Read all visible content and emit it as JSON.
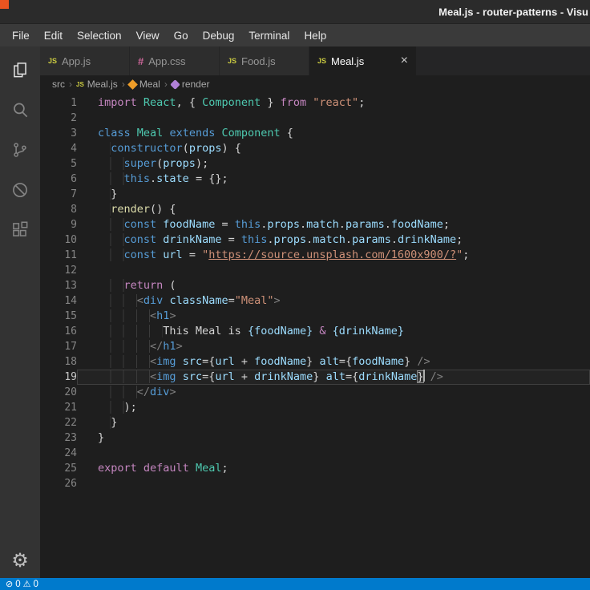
{
  "window": {
    "title": "Meal.js - router-patterns - Visu",
    "corner_marker_color": "#e95420"
  },
  "menu": [
    "File",
    "Edit",
    "Selection",
    "View",
    "Go",
    "Debug",
    "Terminal",
    "Help"
  ],
  "tabs": [
    {
      "label": "App.js",
      "icon": "js",
      "active": false
    },
    {
      "label": "App.css",
      "icon": "css",
      "active": false
    },
    {
      "label": "Food.js",
      "icon": "js",
      "active": false
    },
    {
      "label": "Meal.js",
      "icon": "js",
      "active": true
    }
  ],
  "breadcrumb": [
    {
      "label": "src"
    },
    {
      "label": "Meal.js",
      "icon": "js"
    },
    {
      "label": "Meal",
      "icon": "class"
    },
    {
      "label": "render",
      "icon": "method"
    }
  ],
  "activity_bar": {
    "items": [
      "explorer",
      "search",
      "source-control",
      "debug",
      "extensions"
    ],
    "bottom": [
      "settings-gear"
    ]
  },
  "icons": {
    "close": "×",
    "breadcrumb_separator": "›",
    "error": "⊘",
    "warning": "⚠",
    "settings_gear": "⚙"
  },
  "status_bar": {
    "errors": "0",
    "warnings": "0"
  },
  "theme": {
    "accent": "#007acc",
    "editor_bg": "#1e1e1e",
    "activity_bar_bg": "#333333",
    "tab_bg": "#2d2d2d",
    "tab_active_bg": "#1e1e1e"
  },
  "editor": {
    "lines": [
      {
        "num": 1,
        "tokens": [
          {
            "c": "kw",
            "t": "import"
          },
          {
            "c": "txt",
            "t": " "
          },
          {
            "c": "type",
            "t": "React"
          },
          {
            "c": "txt",
            "t": ", { "
          },
          {
            "c": "type",
            "t": "Component"
          },
          {
            "c": "txt",
            "t": " } "
          },
          {
            "c": "kw",
            "t": "from"
          },
          {
            "c": "txt",
            "t": " "
          },
          {
            "c": "str",
            "t": "\"react\""
          },
          {
            "c": "txt",
            "t": ";"
          }
        ]
      },
      {
        "num": 2,
        "tokens": []
      },
      {
        "num": 3,
        "tokens": [
          {
            "c": "kw2",
            "t": "class"
          },
          {
            "c": "txt",
            "t": " "
          },
          {
            "c": "type",
            "t": "Meal"
          },
          {
            "c": "txt",
            "t": " "
          },
          {
            "c": "kw2",
            "t": "extends"
          },
          {
            "c": "txt",
            "t": " "
          },
          {
            "c": "type",
            "t": "Component"
          },
          {
            "c": "txt",
            "t": " {"
          }
        ]
      },
      {
        "num": 4,
        "tokens": [
          {
            "c": "ind",
            "t": "  "
          },
          {
            "c": "kw2",
            "t": "constructor"
          },
          {
            "c": "txt",
            "t": "("
          },
          {
            "c": "var",
            "t": "props"
          },
          {
            "c": "txt",
            "t": ") {"
          }
        ]
      },
      {
        "num": 5,
        "tokens": [
          {
            "c": "ind",
            "t": "    "
          },
          {
            "c": "kw2",
            "t": "super"
          },
          {
            "c": "txt",
            "t": "("
          },
          {
            "c": "var",
            "t": "props"
          },
          {
            "c": "txt",
            "t": ");"
          }
        ]
      },
      {
        "num": 6,
        "tokens": [
          {
            "c": "ind",
            "t": "    "
          },
          {
            "c": "kw2",
            "t": "this"
          },
          {
            "c": "txt",
            "t": "."
          },
          {
            "c": "var",
            "t": "state"
          },
          {
            "c": "txt",
            "t": " = {};"
          }
        ]
      },
      {
        "num": 7,
        "tokens": [
          {
            "c": "ind",
            "t": "  "
          },
          {
            "c": "txt",
            "t": "}"
          }
        ]
      },
      {
        "num": 8,
        "tokens": [
          {
            "c": "ind",
            "t": "  "
          },
          {
            "c": "fn",
            "t": "render"
          },
          {
            "c": "txt",
            "t": "() {"
          }
        ]
      },
      {
        "num": 9,
        "tokens": [
          {
            "c": "ind",
            "t": "    "
          },
          {
            "c": "kw2",
            "t": "const"
          },
          {
            "c": "txt",
            "t": " "
          },
          {
            "c": "var",
            "t": "foodName"
          },
          {
            "c": "txt",
            "t": " = "
          },
          {
            "c": "kw2",
            "t": "this"
          },
          {
            "c": "txt",
            "t": "."
          },
          {
            "c": "var",
            "t": "props"
          },
          {
            "c": "txt",
            "t": "."
          },
          {
            "c": "var",
            "t": "match"
          },
          {
            "c": "txt",
            "t": "."
          },
          {
            "c": "var",
            "t": "params"
          },
          {
            "c": "txt",
            "t": "."
          },
          {
            "c": "var",
            "t": "foodName"
          },
          {
            "c": "txt",
            "t": ";"
          }
        ]
      },
      {
        "num": 10,
        "tokens": [
          {
            "c": "ind",
            "t": "    "
          },
          {
            "c": "kw2",
            "t": "const"
          },
          {
            "c": "txt",
            "t": " "
          },
          {
            "c": "var",
            "t": "drinkName"
          },
          {
            "c": "txt",
            "t": " = "
          },
          {
            "c": "kw2",
            "t": "this"
          },
          {
            "c": "txt",
            "t": "."
          },
          {
            "c": "var",
            "t": "props"
          },
          {
            "c": "txt",
            "t": "."
          },
          {
            "c": "var",
            "t": "match"
          },
          {
            "c": "txt",
            "t": "."
          },
          {
            "c": "var",
            "t": "params"
          },
          {
            "c": "txt",
            "t": "."
          },
          {
            "c": "var",
            "t": "drinkName"
          },
          {
            "c": "txt",
            "t": ";"
          }
        ]
      },
      {
        "num": 11,
        "tokens": [
          {
            "c": "ind",
            "t": "    "
          },
          {
            "c": "kw2",
            "t": "const"
          },
          {
            "c": "txt",
            "t": " "
          },
          {
            "c": "var",
            "t": "url"
          },
          {
            "c": "txt",
            "t": " = "
          },
          {
            "c": "str",
            "t": "\""
          },
          {
            "c": "link",
            "t": "https://source.unsplash.com/1600x900/?"
          },
          {
            "c": "str",
            "t": "\""
          },
          {
            "c": "txt",
            "t": ";"
          }
        ]
      },
      {
        "num": 12,
        "tokens": []
      },
      {
        "num": 13,
        "tokens": [
          {
            "c": "ind",
            "t": "    "
          },
          {
            "c": "kw",
            "t": "return"
          },
          {
            "c": "txt",
            "t": " ("
          }
        ]
      },
      {
        "num": 14,
        "tokens": [
          {
            "c": "ind",
            "t": "      "
          },
          {
            "c": "pn",
            "t": "<"
          },
          {
            "c": "tag",
            "t": "div"
          },
          {
            "c": "txt",
            "t": " "
          },
          {
            "c": "var",
            "t": "className"
          },
          {
            "c": "txt",
            "t": "="
          },
          {
            "c": "str",
            "t": "\"Meal\""
          },
          {
            "c": "pn",
            "t": ">"
          }
        ]
      },
      {
        "num": 15,
        "tokens": [
          {
            "c": "ind",
            "t": "        "
          },
          {
            "c": "pn",
            "t": "<"
          },
          {
            "c": "tag",
            "t": "h1"
          },
          {
            "c": "pn",
            "t": ">"
          }
        ]
      },
      {
        "num": 16,
        "tokens": [
          {
            "c": "ind",
            "t": "          "
          },
          {
            "c": "txt",
            "t": "This Meal is "
          },
          {
            "c": "var",
            "t": "{foodName}"
          },
          {
            "c": "txt",
            "t": " "
          },
          {
            "c": "ent",
            "t": "&"
          },
          {
            "c": "txt",
            "t": " "
          },
          {
            "c": "var",
            "t": "{drinkName}"
          }
        ]
      },
      {
        "num": 17,
        "tokens": [
          {
            "c": "ind",
            "t": "        "
          },
          {
            "c": "pn",
            "t": "</"
          },
          {
            "c": "tag",
            "t": "h1"
          },
          {
            "c": "pn",
            "t": ">"
          }
        ]
      },
      {
        "num": 18,
        "tokens": [
          {
            "c": "ind",
            "t": "        "
          },
          {
            "c": "pn",
            "t": "<"
          },
          {
            "c": "tag",
            "t": "img"
          },
          {
            "c": "txt",
            "t": " "
          },
          {
            "c": "var",
            "t": "src"
          },
          {
            "c": "txt",
            "t": "={"
          },
          {
            "c": "var",
            "t": "url"
          },
          {
            "c": "txt",
            "t": " + "
          },
          {
            "c": "var",
            "t": "foodName"
          },
          {
            "c": "txt",
            "t": "} "
          },
          {
            "c": "var",
            "t": "alt"
          },
          {
            "c": "txt",
            "t": "={"
          },
          {
            "c": "var",
            "t": "foodName"
          },
          {
            "c": "txt",
            "t": "} "
          },
          {
            "c": "pn",
            "t": "/>"
          }
        ]
      },
      {
        "num": 19,
        "current": true,
        "tokens": [
          {
            "c": "ind",
            "t": "        "
          },
          {
            "c": "pn",
            "t": "<"
          },
          {
            "c": "tag",
            "t": "img"
          },
          {
            "c": "txt",
            "t": " "
          },
          {
            "c": "var",
            "t": "src"
          },
          {
            "c": "txt",
            "t": "={"
          },
          {
            "c": "var",
            "t": "url"
          },
          {
            "c": "txt",
            "t": " + "
          },
          {
            "c": "var",
            "t": "drinkName"
          },
          {
            "c": "txt",
            "t": "} "
          },
          {
            "c": "var",
            "t": "alt"
          },
          {
            "c": "txt",
            "t": "={"
          },
          {
            "c": "var",
            "t": "drinkName"
          },
          {
            "c": "bm",
            "t": "}"
          },
          {
            "c": "cursor",
            "t": ""
          },
          {
            "c": "txt",
            "t": " "
          },
          {
            "c": "pn",
            "t": "/>"
          }
        ]
      },
      {
        "num": 20,
        "tokens": [
          {
            "c": "ind",
            "t": "      "
          },
          {
            "c": "pn",
            "t": "</"
          },
          {
            "c": "tag",
            "t": "div"
          },
          {
            "c": "pn",
            "t": ">"
          }
        ]
      },
      {
        "num": 21,
        "tokens": [
          {
            "c": "ind",
            "t": "    "
          },
          {
            "c": "txt",
            "t": ");"
          }
        ]
      },
      {
        "num": 22,
        "tokens": [
          {
            "c": "ind",
            "t": "  "
          },
          {
            "c": "txt",
            "t": "}"
          }
        ]
      },
      {
        "num": 23,
        "tokens": [
          {
            "c": "txt",
            "t": "}"
          }
        ]
      },
      {
        "num": 24,
        "tokens": []
      },
      {
        "num": 25,
        "tokens": [
          {
            "c": "kw",
            "t": "export"
          },
          {
            "c": "txt",
            "t": " "
          },
          {
            "c": "kw",
            "t": "default"
          },
          {
            "c": "txt",
            "t": " "
          },
          {
            "c": "type",
            "t": "Meal"
          },
          {
            "c": "txt",
            "t": ";"
          }
        ]
      },
      {
        "num": 26,
        "tokens": []
      }
    ]
  }
}
